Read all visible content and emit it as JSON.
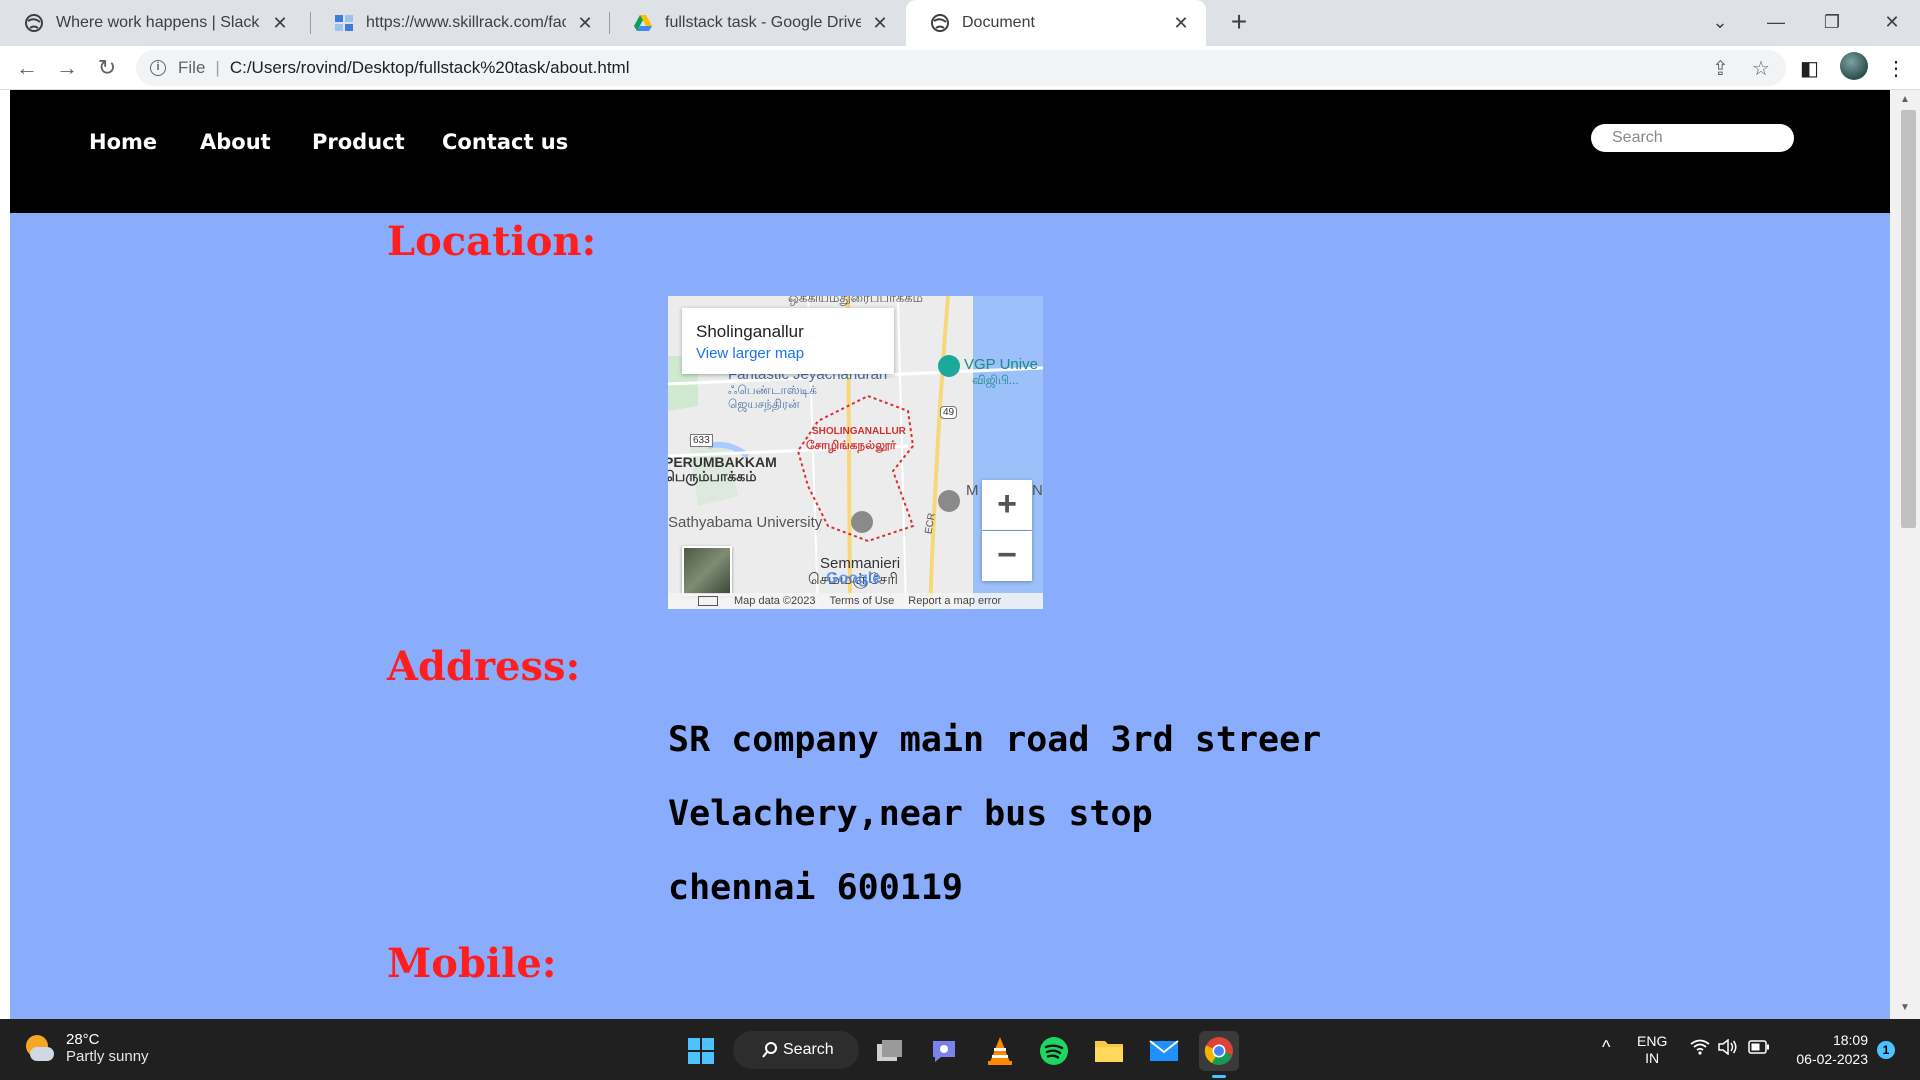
{
  "browser": {
    "tabs": [
      {
        "title": "Where work happens | Slack",
        "icon": "globe-icon",
        "active": false
      },
      {
        "title": "https://www.skillrack.com/faces/c",
        "icon": "skillrack-icon",
        "active": false
      },
      {
        "title": "fullstack task - Google Drive",
        "icon": "google-drive-icon",
        "active": false
      },
      {
        "title": "Document",
        "icon": "globe-icon",
        "active": true
      }
    ],
    "close_glyph": "✕",
    "new_tab_glyph": "+",
    "address": {
      "scheme_label": "File",
      "url": "C:/Users/rovind/Desktop/fullstack%20task/about.html"
    }
  },
  "page": {
    "nav": {
      "items": [
        "Home",
        "About",
        "Product",
        "Contact us"
      ],
      "search_placeholder": "Search"
    },
    "location_heading": "Location:",
    "map": {
      "place_name": "Sholinganallur",
      "view_larger": "View larger map",
      "labels": {
        "top_cut": "ஒக்கியம்துரைப்பாக்கம்",
        "vgp": "VGP Unive",
        "vgp_ta": "விஜிபி...",
        "fantastic": "Fantastic Jeyachandran",
        "fantastic_ta1": "ஃபெண்டாஸ்டிக்",
        "fantastic_ta2": "ஜெயசந்திரன்",
        "road_633": "633",
        "road_49": "49",
        "sholinganallur_en": "SHOLINGANALLUR",
        "sholinganallur_ta": "சோழிங்கநல்லூர்",
        "perumbakkam_en": "PERUMBAKKAM",
        "perumbakkam_ta": "பெரும்பாக்கம்",
        "sathyabama": "Sathyabama University",
        "ecr": "ECR",
        "semmanieri": "Semmanieri",
        "semmanieri_ta": "செம்மஞ்சேரி",
        "m_cut": "M",
        "n_cut": "N",
        "google": "Google"
      },
      "zoom_in": "+",
      "zoom_out": "−",
      "footer": [
        "Map data ©2023",
        "Terms of Use",
        "Report a map error"
      ]
    },
    "address_heading": "Address:",
    "address_lines": [
      "SR company main road 3rd streer",
      "Velachery,near bus stop",
      "chennai 600119"
    ],
    "mobile_heading": "Mobile:"
  },
  "taskbar": {
    "weather": {
      "temp": "28°C",
      "condition": "Partly sunny"
    },
    "search_label": "Search",
    "apps": [
      "windows-start-icon",
      "search-icon",
      "task-view-icon",
      "teams-chat-icon",
      "vlc-icon",
      "spotify-icon",
      "file-explorer-icon",
      "mail-icon",
      "chrome-icon"
    ],
    "lang": {
      "line1": "ENG",
      "line2": "IN"
    },
    "time": "18:09",
    "date": "06-02-2023",
    "notifications": "1"
  },
  "colors": {
    "page_bg": "#89acfc",
    "nav_bg": "#000000",
    "heading": "#ff1d1d",
    "taskbar": "#202020"
  }
}
